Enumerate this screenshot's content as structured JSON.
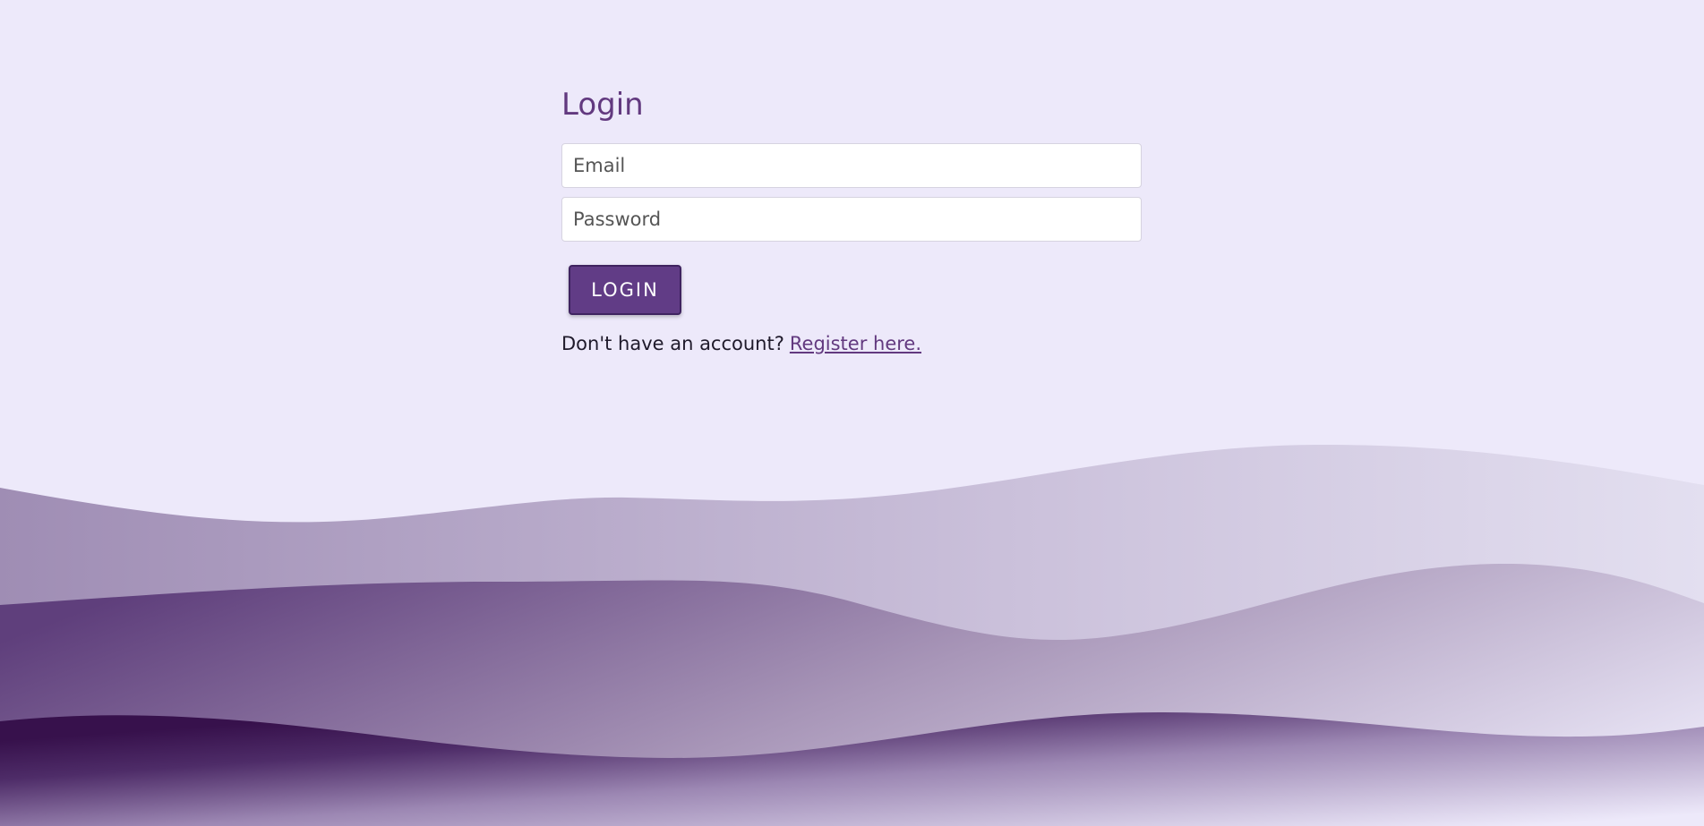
{
  "login": {
    "title": "Login",
    "email_placeholder": "Email",
    "password_placeholder": "Password",
    "button_label": "LOGIN",
    "register_prompt": "Don't have an account?",
    "register_link": "Register here."
  },
  "colors": {
    "background": "#ede9fa",
    "accent": "#62397f",
    "button": "#613c86",
    "wave_dark": "#37114c"
  }
}
